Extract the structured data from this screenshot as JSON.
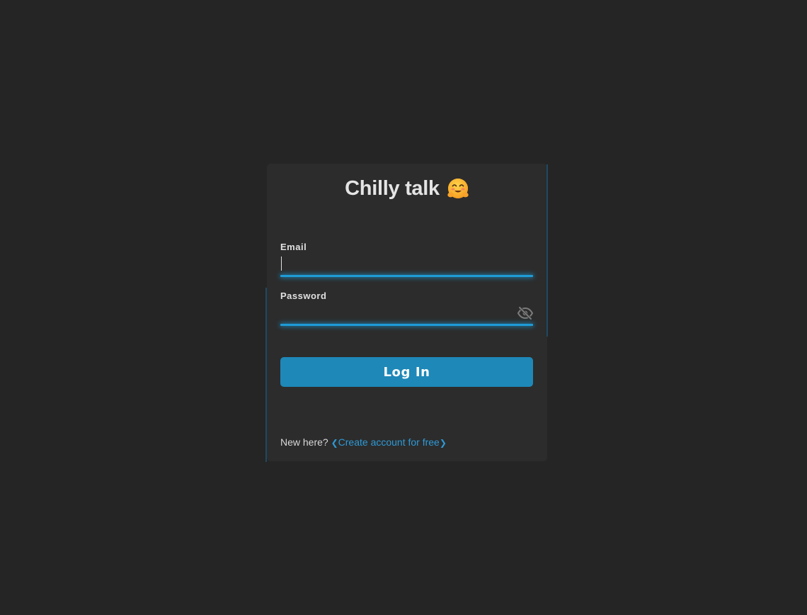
{
  "app": {
    "title": "Chilly talk",
    "title_icon": "hugging-face-emoji"
  },
  "form": {
    "email": {
      "label": "Email",
      "value": "",
      "placeholder": ""
    },
    "password": {
      "label": "Password",
      "value": "",
      "placeholder": "",
      "toggle_icon": "eye-slash-icon"
    },
    "submit_label": "Log In"
  },
  "footer": {
    "prompt": "New here?",
    "link_open": "❮",
    "link_label": "Create account for free",
    "link_close": "❯"
  },
  "colors": {
    "background": "#252525",
    "card": "#2c2c2c",
    "accent": "#1e9bd7",
    "button": "#1e88b8",
    "link": "#2d9ad6"
  }
}
